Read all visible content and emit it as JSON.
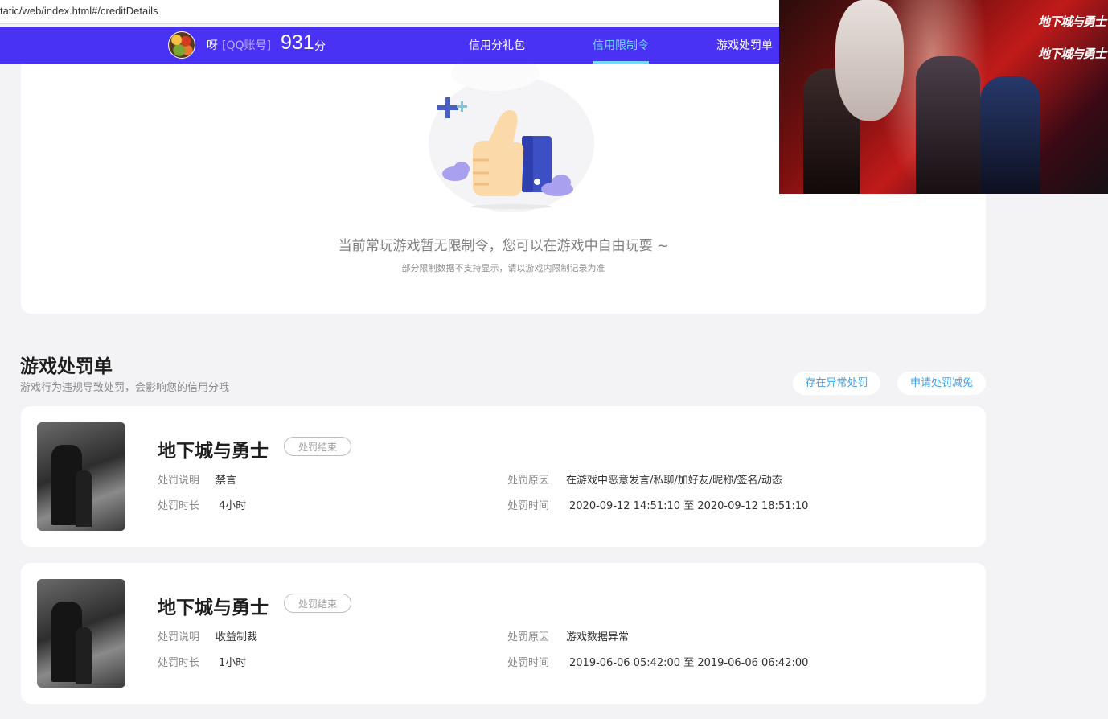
{
  "browser": {
    "url": "tatic/web/index.html#/creditDetails"
  },
  "header": {
    "user_name": "呀",
    "account_type": "[QQ账号]",
    "score": "931",
    "score_unit": "分",
    "tabs": [
      {
        "label": "信用分礼包",
        "active": false
      },
      {
        "label": "信用限制令",
        "active": true
      },
      {
        "label": "游戏处罚单",
        "active": false
      }
    ],
    "colors": {
      "nav_bg": "#4a32f5",
      "active_tab": "#74d8ff"
    }
  },
  "restriction": {
    "empty_title": "当前常玩游戏暂无限制令，您可以在游戏中自由玩耍 ~",
    "empty_subtitle": "部分限制数据不支持显示，请以游戏内限制记录为准",
    "illustration_icon": "thumbs-up-icon"
  },
  "penalties": {
    "title": "游戏处罚单",
    "subtitle": "游戏行为违规导致处罚，会影响您的信用分哦",
    "actions": [
      "存在异常处罚",
      "申请处罚减免"
    ],
    "labels": {
      "desc": "处罚说明",
      "duration": "处罚时长",
      "reason": "处罚原因",
      "time": "处罚时间"
    },
    "items": [
      {
        "game": "地下城与勇士",
        "status": "处罚结束",
        "desc": "禁言",
        "duration": "4小时",
        "reason": "在游戏中恶意发言/私聊/加好友/昵称/签名/动态",
        "time": "2020-09-12 14:51:10 至 2020-09-12 18:51:10"
      },
      {
        "game": "地下城与勇士",
        "status": "处罚结束",
        "desc": "收益制裁",
        "duration": "1小时",
        "reason": "游戏数据异常",
        "time": "2019-06-06 05:42:00 至 2019-06-06 06:42:00"
      }
    ]
  },
  "ad": {
    "logo_text": "地下城与勇士"
  }
}
